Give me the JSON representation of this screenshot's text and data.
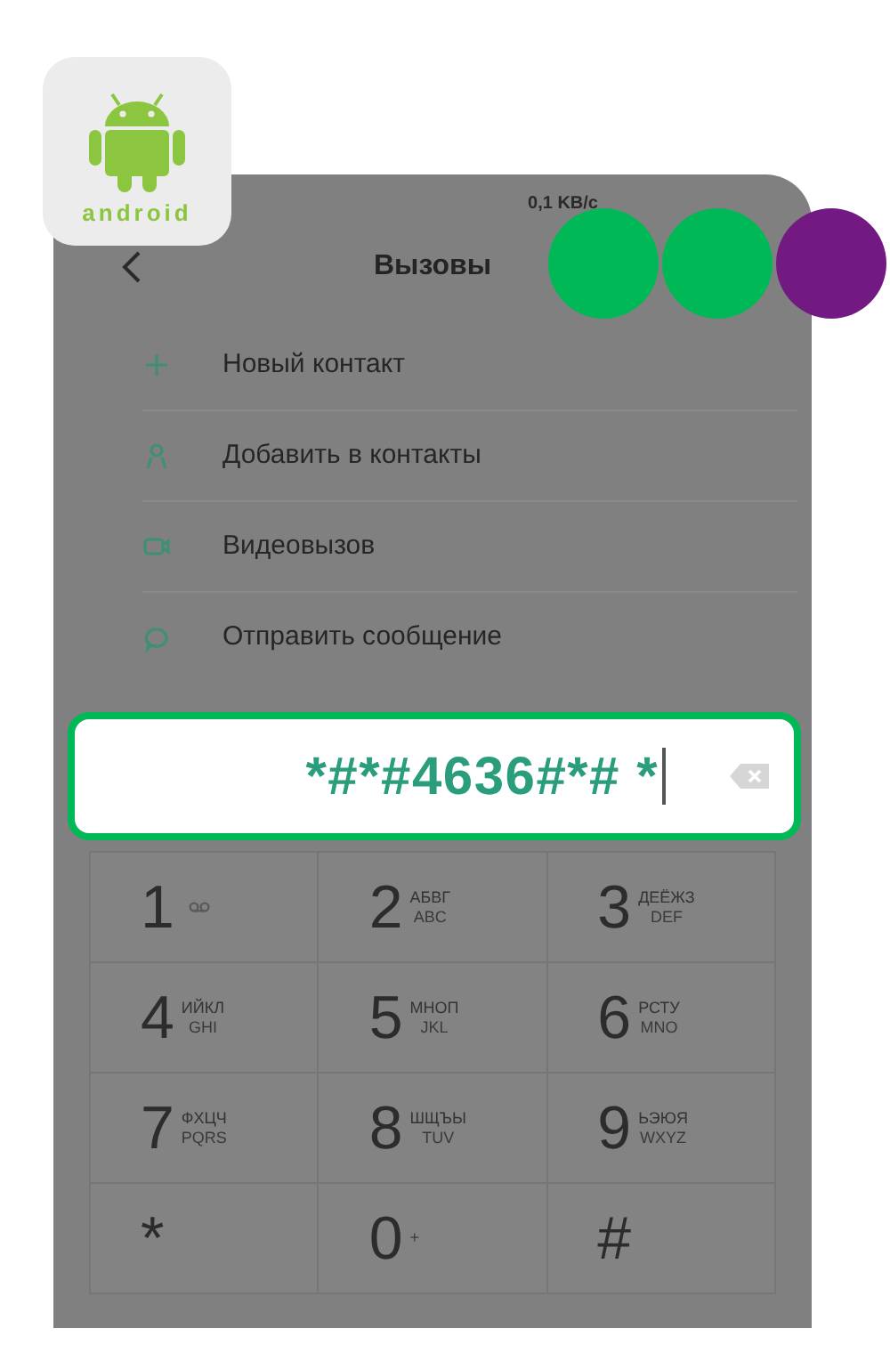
{
  "logo": {
    "text": "android"
  },
  "status_bar": {
    "speed": "0,1 KB/c"
  },
  "header": {
    "title": "Вызовы"
  },
  "menu": [
    {
      "kind": "add",
      "label": "Новый контакт"
    },
    {
      "kind": "person",
      "label": "Добавить в контакты"
    },
    {
      "kind": "video",
      "label": "Видеовызов"
    },
    {
      "kind": "message",
      "label": "Отправить сообщение"
    }
  ],
  "dial_field": {
    "value": "*#*#4636#*# *"
  },
  "keys": [
    {
      "digit": "1",
      "kind": "voicemail"
    },
    {
      "digit": "2",
      "letters": "АБВГ",
      "latin": "ABC"
    },
    {
      "digit": "3",
      "letters": "ДЕЁЖЗ",
      "latin": "DEF"
    },
    {
      "digit": "4",
      "letters": "ИЙКЛ",
      "latin": "GHI"
    },
    {
      "digit": "5",
      "letters": "МНОП",
      "latin": "JKL"
    },
    {
      "digit": "6",
      "letters": "РСТУ",
      "latin": "MNO"
    },
    {
      "digit": "7",
      "letters": "ФХЦЧ",
      "latin": "PQRS"
    },
    {
      "digit": "8",
      "letters": "ШЩЪЫ",
      "latin": "TUV"
    },
    {
      "digit": "9",
      "letters": "ЬЭЮЯ",
      "latin": "WXYZ"
    },
    {
      "digit": "*"
    },
    {
      "digit": "0",
      "latin": "+"
    },
    {
      "digit": "#"
    }
  ],
  "dots": [
    {
      "color": "#00b956"
    },
    {
      "color": "#00b956"
    },
    {
      "color": "#731982"
    }
  ]
}
